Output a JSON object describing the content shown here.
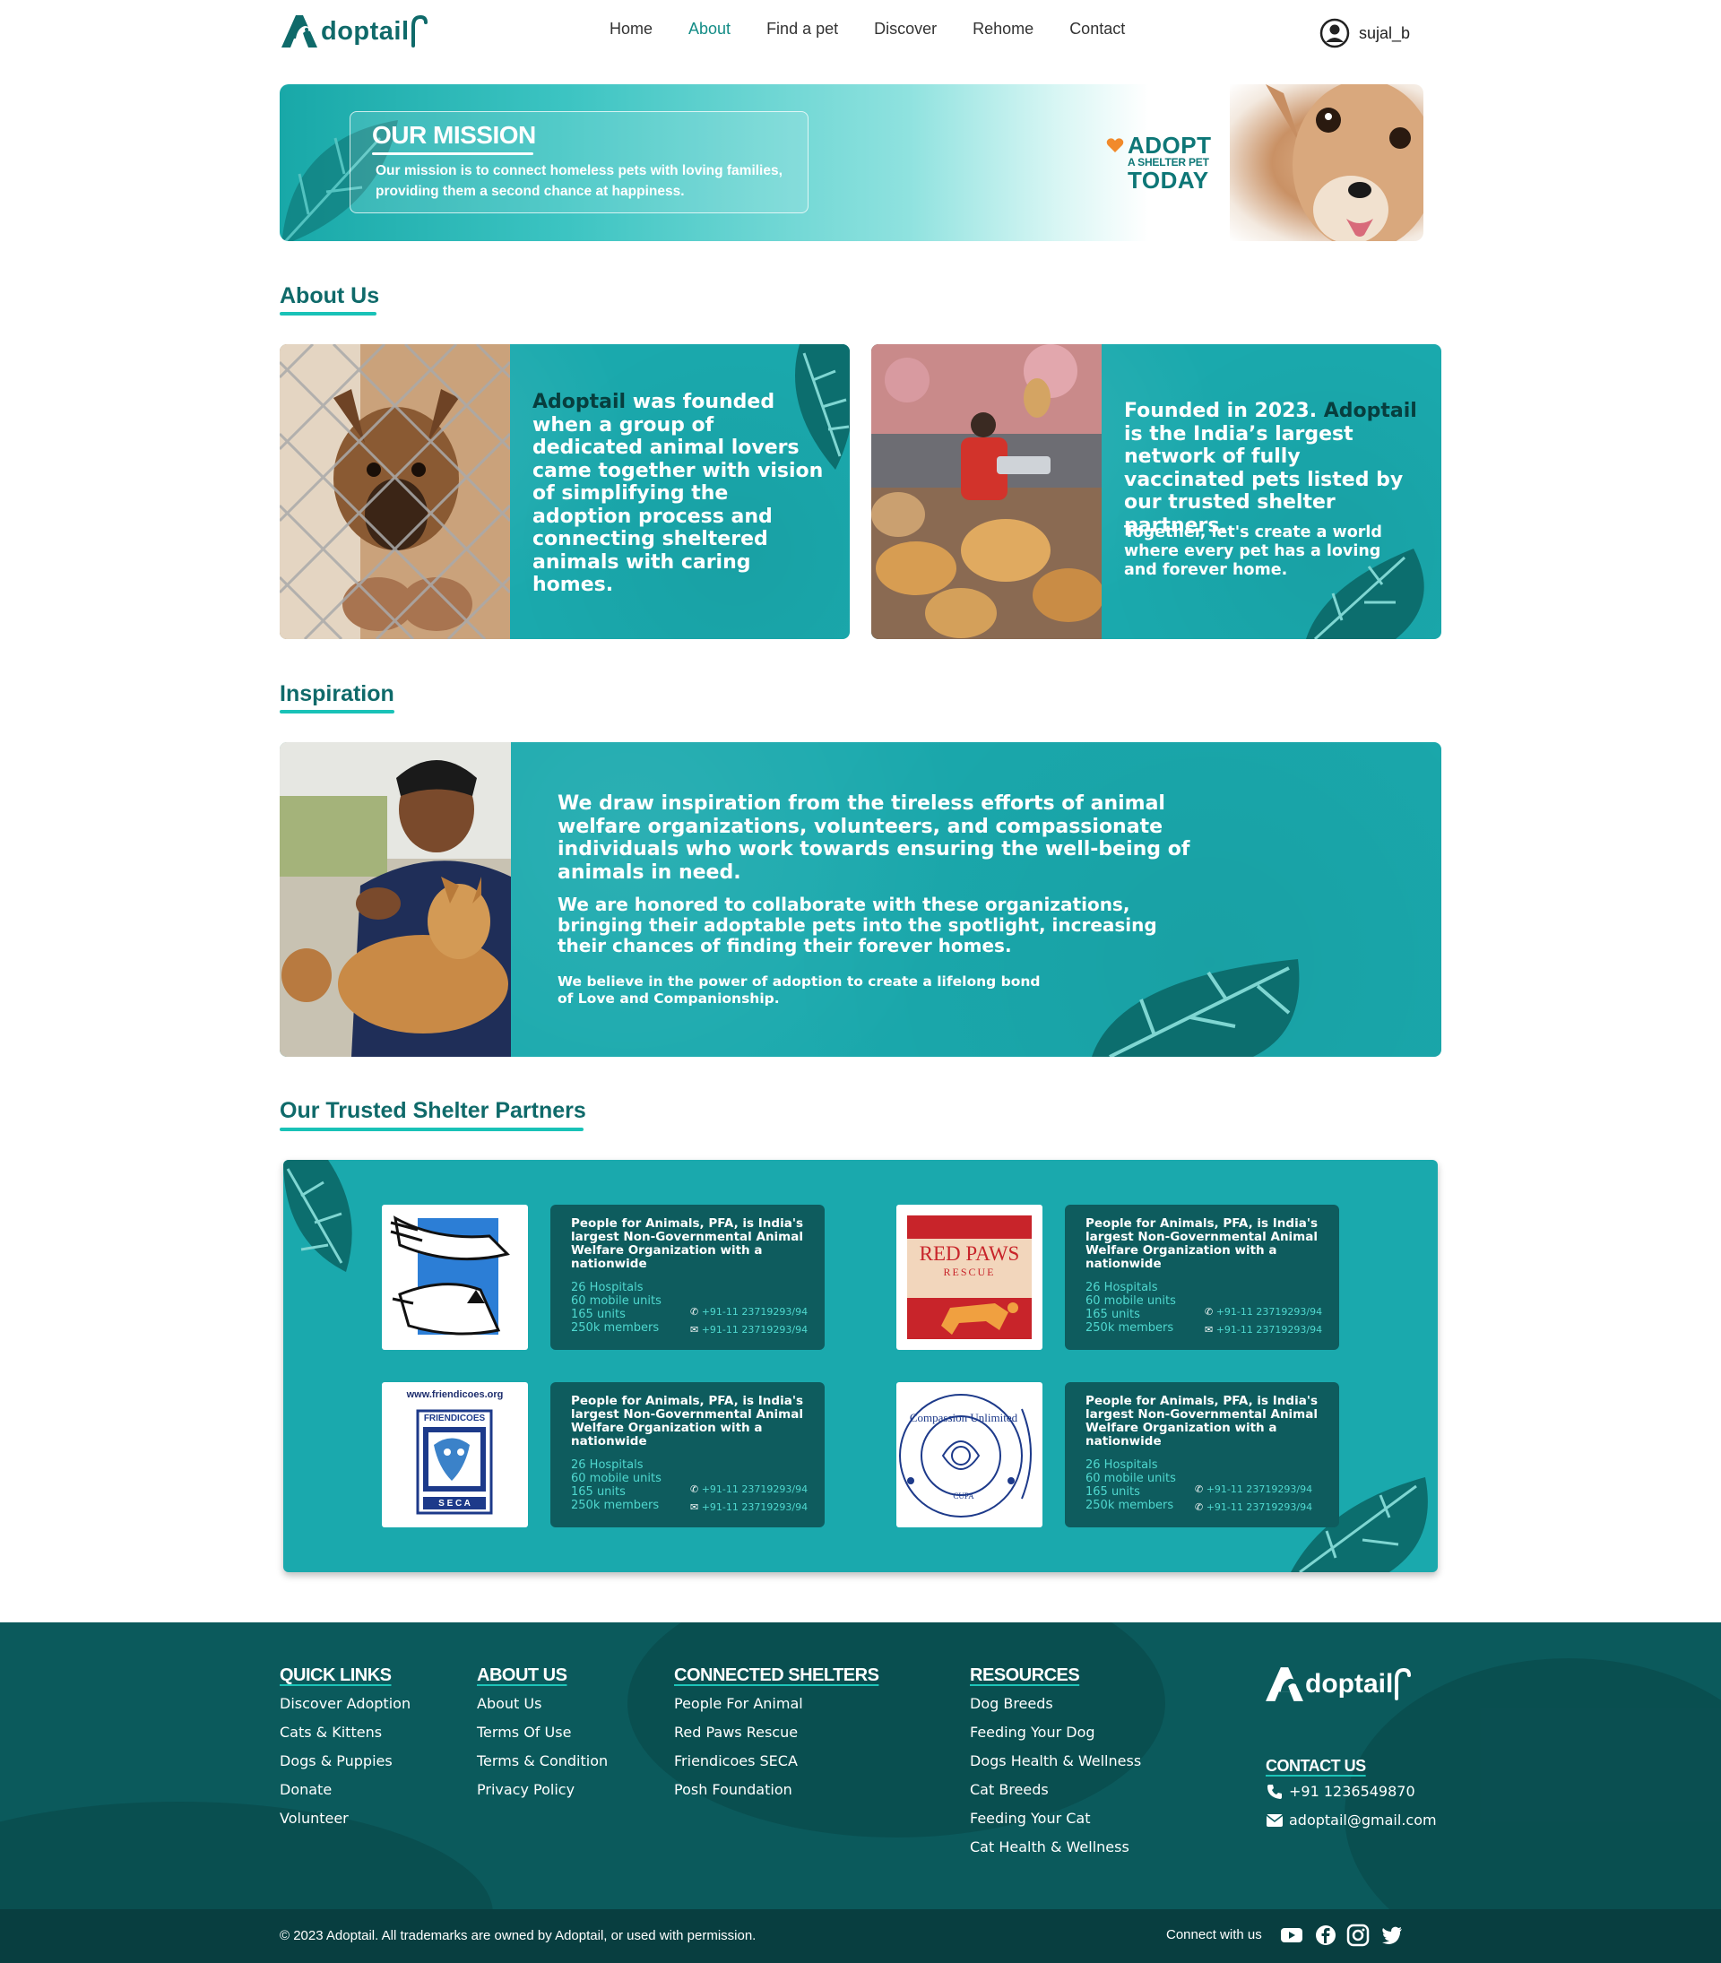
{
  "brand": {
    "name": "doptail",
    "primary": "#138c86",
    "teal": "#1aa9ad",
    "dark_teal": "#0b5a5c"
  },
  "nav": {
    "links": [
      "Home",
      "About",
      "Find a pet",
      "Discover",
      "Rehome",
      "Contact"
    ],
    "active": "About",
    "user_icon": "user-avatar-icon",
    "username": "sujal_b"
  },
  "banner": {
    "title": "OUR MISSION",
    "text": "Our mission is to connect homeless pets with loving families, providing them a second chance at happiness.",
    "adopt": "ADOPT",
    "shelter": "A SHELTER PET",
    "today": "TODAY"
  },
  "about": {
    "heading": "About Us",
    "card1": {
      "brand": "Adoptail",
      "text": " was founded when a group of dedicated animal lovers  came together with vision of simplifying the adoption process and connecting sheltered animals with caring homes."
    },
    "card2": {
      "lead": "Founded in 2023. ",
      "brand": "Adoptail",
      "text": " is the India’s largest network of fully vaccinated pets listed by our trusted shelter partners.",
      "sub": "Together, let's create a world where every pet has a loving and forever home."
    }
  },
  "inspiration": {
    "heading": "Inspiration",
    "p1": "We draw inspiration from the tireless efforts of animal welfare organizations, volunteers, and compassionate individuals who work towards ensuring the well-being of animals in need.",
    "p2": "We are honored to collaborate with these organizations, bringing their adoptable pets into the spotlight, increasing their chances of finding their forever homes.",
    "p3": "We believe in the power of adoption to create a lifelong bond of Love and Companionship."
  },
  "partners": {
    "heading": "Our Trusted Shelter Partners",
    "items": [
      {
        "desc": "People for Animals, PFA, is India's largest Non-Governmental Animal Welfare Organization with a nationwide",
        "stats": [
          "26 Hospitals",
          "60 mobile units",
          "165 units",
          "250k  members"
        ],
        "phone": "+91-11 23719293/94",
        "email": "+91-11 23719293/94"
      },
      {
        "desc": "People for Animals, PFA, is India's largest Non-Governmental Animal Welfare Organization with a nationwide",
        "stats": [
          "26 Hospitals",
          "60 mobile units",
          "165 units",
          "250k  members"
        ],
        "phone": "+91-11 23719293/94",
        "email": "+91-11 23719293/94",
        "logo_title": "RED PAWS",
        "logo_sub": "RESCUE"
      },
      {
        "desc": "People for Animals, PFA, is India's largest Non-Governmental Animal Welfare Organization with a nationwide",
        "stats": [
          "26 Hospitals",
          "60 mobile units",
          "165 units",
          "250k  members"
        ],
        "phone": "+91-11 23719293/94",
        "email": "+91-11 23719293/94",
        "logo_url": "www.friendicoes.org",
        "logo_title": "FRIENDICOES",
        "logo_sub": "S E C A"
      },
      {
        "desc": "People for Animals, PFA, is India's largest Non-Governmental Animal Welfare Organization with a nationwide",
        "stats": [
          "26 Hospitals",
          "60 mobile units",
          "165 units",
          "250k  members"
        ],
        "phone": "+91-11 23719293/94",
        "email": "+91-11 23719293/94",
        "logo_title": "Compassion Unlimited",
        "logo_sub": "CUPA"
      }
    ]
  },
  "footer": {
    "quick_links": {
      "title": "QUICK LINKS",
      "items": [
        "Discover Adoption",
        "Cats & Kittens",
        "Dogs & Puppies",
        "Donate",
        "Volunteer"
      ]
    },
    "about_us": {
      "title": "ABOUT US",
      "items": [
        "About Us",
        "Terms Of Use",
        "Terms & Condition",
        "Privacy Policy"
      ]
    },
    "connected": {
      "title": "CONNECTED SHELTERS",
      "items": [
        "People For Animal",
        "Red Paws Rescue",
        "Friendicoes SECA",
        "Posh Foundation"
      ]
    },
    "resources": {
      "title": "RESOURCES",
      "items": [
        "Dog Breeds",
        "Feeding Your Dog",
        "Dogs Health & Wellness",
        "Cat Breeds",
        "Feeding Your Cat",
        "Cat Health & Wellness"
      ]
    },
    "contact": {
      "title": "CONTACT US",
      "phone": "+91 1236549870",
      "email": "adoptail@gmail.com"
    },
    "copyright": "© 2023 Adoptail. All trademarks are owned by Adoptail, or used with permission.",
    "connect": "Connect with us",
    "social": [
      "youtube-icon",
      "facebook-icon",
      "instagram-icon",
      "twitter-icon"
    ]
  }
}
